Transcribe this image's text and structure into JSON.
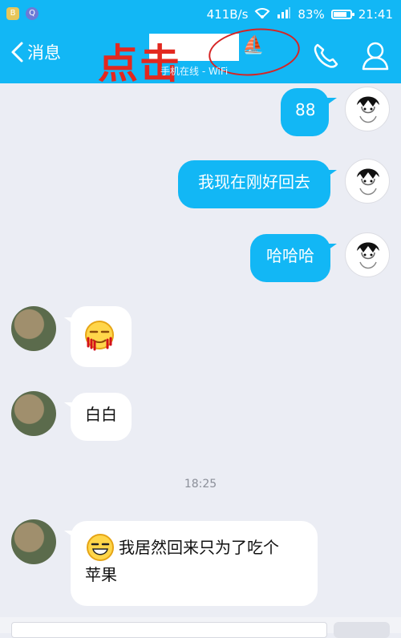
{
  "status_bar": {
    "app_badge_1": "B",
    "app_badge_2": "Q",
    "network_speed": "411B/s",
    "signal_label": "4G",
    "battery_percent": "83%",
    "battery_level": 0.83,
    "time": "21:41"
  },
  "header": {
    "back_label": "消息",
    "annotation_text": "点击",
    "subtitle": "手机在线 - WiFi",
    "icons": {
      "back": "chevron-left-icon",
      "boat": "sailboat-icon",
      "call": "phone-icon",
      "profile": "person-icon"
    }
  },
  "messages": [
    {
      "from": "me",
      "text": "88"
    },
    {
      "from": "me",
      "text": "我现在刚好回去"
    },
    {
      "from": "me",
      "text": "哈哈哈"
    },
    {
      "from": "friend",
      "text": "",
      "emoji": "nosebleed-emoji-icon"
    },
    {
      "from": "friend",
      "text": "白白"
    },
    {
      "from": "friend",
      "text_line1": "我居然回来只为了吃个",
      "text_line2": "苹果",
      "emoji": "grin-emoji-icon"
    }
  ],
  "timestamp": "18:25",
  "colors": {
    "accent": "#12b7f5",
    "annotation_red": "#e3281f",
    "background": "#ebedf4"
  }
}
